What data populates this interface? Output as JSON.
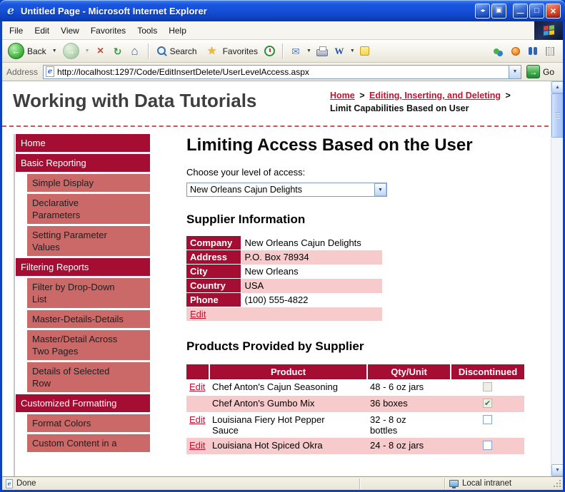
{
  "window": {
    "title": "Untitled Page - Microsoft Internet Explorer"
  },
  "menu": {
    "items": [
      "File",
      "Edit",
      "View",
      "Favorites",
      "Tools",
      "Help"
    ]
  },
  "toolbar": {
    "back": "Back",
    "search": "Search",
    "favorites": "Favorites"
  },
  "address": {
    "label": "Address",
    "url": "http://localhost:1297/Code/EditInsertDelete/UserLevelAccess.aspx",
    "go": "Go"
  },
  "masthead": {
    "site_title": "Working with Data Tutorials",
    "breadcrumb": {
      "home": "Home",
      "sep1": ">",
      "section": "Editing, Inserting, and Deleting",
      "sep2": ">",
      "current": "Limit Capabilities Based on User"
    }
  },
  "sidebar": {
    "items": [
      {
        "label": "Home",
        "type": "header"
      },
      {
        "label": "Basic Reporting",
        "type": "header"
      },
      {
        "label": "Simple Display",
        "type": "sub"
      },
      {
        "label": "Declarative Parameters",
        "type": "sub"
      },
      {
        "label": "Setting Parameter Values",
        "type": "sub"
      },
      {
        "label": "Filtering Reports",
        "type": "header"
      },
      {
        "label": "Filter by Drop-Down List",
        "type": "sub"
      },
      {
        "label": "Master-Details-Details",
        "type": "sub"
      },
      {
        "label": "Master/Detail Across Two Pages",
        "type": "sub"
      },
      {
        "label": "Details of Selected Row",
        "type": "sub"
      },
      {
        "label": "Customized Formatting",
        "type": "header"
      },
      {
        "label": "Format Colors",
        "type": "sub"
      },
      {
        "label": "Custom Content in a",
        "type": "sub"
      }
    ]
  },
  "main": {
    "page_title": "Limiting Access Based on the User",
    "access_label": "Choose your level of access:",
    "access_value": "New Orleans Cajun Delights",
    "supplier": {
      "section_title": "Supplier Information",
      "rows": [
        {
          "label": "Company",
          "value": "New Orleans Cajun Delights"
        },
        {
          "label": "Address",
          "value": "P.O. Box 78934"
        },
        {
          "label": "City",
          "value": "New Orleans"
        },
        {
          "label": "Country",
          "value": "USA"
        },
        {
          "label": "Phone",
          "value": "(100) 555-4822"
        }
      ],
      "edit": "Edit"
    },
    "products": {
      "section_title": "Products Provided by Supplier",
      "columns": {
        "edit": "",
        "product": "Product",
        "qty": "Qty/Unit",
        "discontinued": "Discontinued"
      },
      "rows": [
        {
          "edit": "Edit",
          "product": "Chef Anton's Cajun Seasoning",
          "qty": "48 - 6 oz jars",
          "discontinued": false,
          "checkbox_disabled": true
        },
        {
          "edit": "",
          "product": "Chef Anton's Gumbo Mix",
          "qty": "36 boxes",
          "discontinued": true,
          "checkbox_disabled": true
        },
        {
          "edit": "Edit",
          "product": "Louisiana Fiery Hot Pepper Sauce",
          "qty": "32 - 8 oz bottles",
          "discontinued": false,
          "checkbox_disabled": false
        },
        {
          "edit": "Edit",
          "product": "Louisiana Hot Spiced Okra",
          "qty": "24 - 8 oz jars",
          "discontinued": false,
          "checkbox_disabled": false
        }
      ]
    }
  },
  "statusbar": {
    "status": "Done",
    "zone": "Local intranet"
  },
  "icons": {
    "ie_logo": "e",
    "back_arrow": "←",
    "forward_arrow": "→",
    "dropdown_arrow": "▼",
    "up_arrow": "▲",
    "stop": "×",
    "refresh": "↻",
    "home": "⌂",
    "favorites_star": "★",
    "mail": "✉",
    "word": "W",
    "go_arrow": "→",
    "restore_arrows": "◂▸",
    "screen": "▣",
    "minimize": "—",
    "maximize": "□",
    "close": "×",
    "check": "✔"
  },
  "colors": {
    "accent_red": "#A60D33",
    "nav_sub": "#CB6868",
    "row_pink": "#F7CBCB",
    "link_red": "#C41230",
    "titlebar_blue": "#1550D8",
    "go_green": "#2FA33F"
  }
}
